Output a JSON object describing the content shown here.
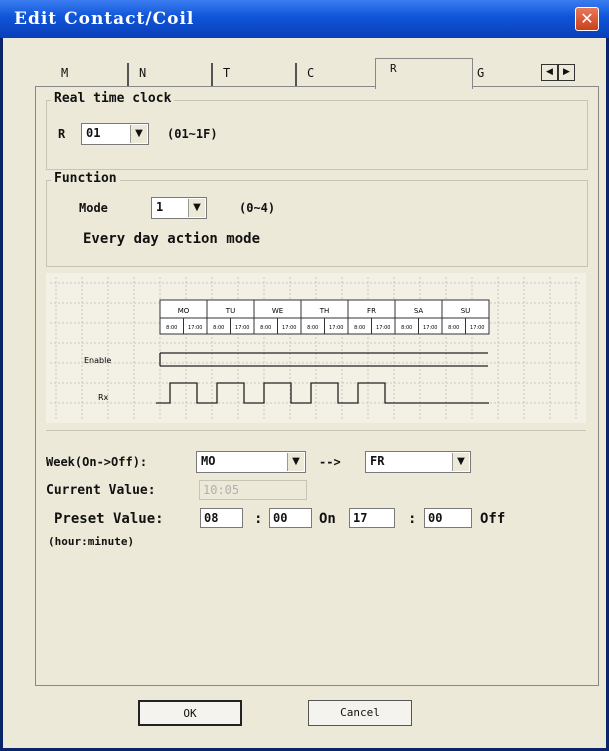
{
  "window": {
    "title": "Edit Contact/Coil"
  },
  "tabs": [
    "M",
    "N",
    "T",
    "C",
    "R",
    "G"
  ],
  "rtc_group": {
    "label": "Real time clock",
    "prefix": "R",
    "selected": "01",
    "range": "(01~1F)"
  },
  "function_group": {
    "label": "Function",
    "mode_label": "Mode",
    "mode_value": "1",
    "mode_range": "(0~4)",
    "mode_description": "Every day action mode"
  },
  "diagram": {
    "days": [
      "MO",
      "TU",
      "WE",
      "TH",
      "FR",
      "SA",
      "SU"
    ],
    "times": [
      "8:00",
      "17:00",
      "8:00",
      "17:00",
      "8:00",
      "17:00",
      "8:00",
      "17:00",
      "8:00",
      "17:00",
      "8:00",
      "17:00",
      "8:00",
      "17:00"
    ],
    "enable_label": "Enable",
    "output_label": "Rx",
    "output_pulses": [
      1,
      1,
      1,
      1,
      1,
      0,
      0
    ]
  },
  "week": {
    "label": "Week(On->Off):",
    "from": "MO",
    "arrow": "-->",
    "to": "FR"
  },
  "current": {
    "label": "Current Value:",
    "value": "10:05"
  },
  "preset": {
    "label": "Preset Value:",
    "on_hour": "08",
    "on_min": "00",
    "on_label": "On",
    "off_hour": "17",
    "off_min": "00",
    "off_label": "Off",
    "colon": ":",
    "hint": "(hour:minute)"
  },
  "buttons": {
    "ok": "OK",
    "cancel": "Cancel"
  }
}
